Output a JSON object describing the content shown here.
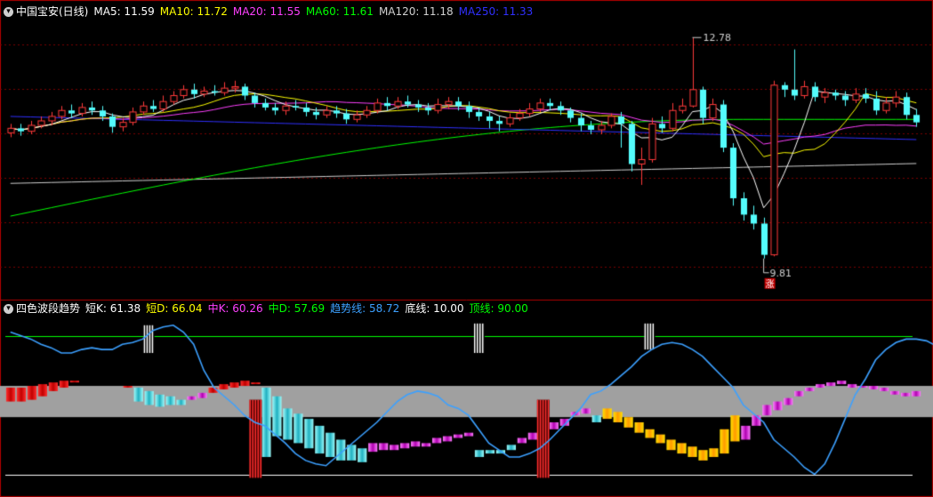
{
  "main_chart": {
    "title": "中国宝安(日线)",
    "ma": [
      {
        "label": "MA5: 11.59",
        "color": "#ffffff"
      },
      {
        "label": "MA10: 11.72",
        "color": "#ffff00"
      },
      {
        "label": "MA20: 11.55",
        "color": "#ff40ff"
      },
      {
        "label": "MA60: 11.61",
        "color": "#00ff00"
      },
      {
        "label": "MA120: 11.18",
        "color": "#d0d0d0"
      },
      {
        "label": "MA250: 11.33",
        "color": "#3030ff"
      }
    ],
    "high_label": "12.78",
    "low_label": "9.81",
    "limit_badge": "涨",
    "colors": {
      "up": "#ff3a3a",
      "down": "#54fcfc",
      "grid": "#7a0000",
      "border": "#b00000"
    }
  },
  "indicator": {
    "title": "四色波段趋势",
    "items": [
      {
        "label": "短K: 61.38",
        "color": "#ffffff"
      },
      {
        "label": "短D: 66.04",
        "color": "#ffff00"
      },
      {
        "label": "中K: 60.26",
        "color": "#ff40ff"
      },
      {
        "label": "中D: 57.69",
        "color": "#00ff00"
      },
      {
        "label": "趋势线: 58.72",
        "color": "#3ca0ff"
      },
      {
        "label": "底线: 10.00",
        "color": "#ffffff"
      },
      {
        "label": "顶线: 90.00",
        "color": "#00ff00"
      }
    ],
    "bottom_line": 10,
    "top_line": 90,
    "colors": {
      "red": "#e01010",
      "yellow": "#ffcc00",
      "cyan": "#54fcfc",
      "magenta": "#ff40ff",
      "trend": "#3ca0ff",
      "band": "#a0a0a0"
    }
  },
  "chart_data": {
    "type": "candlestick",
    "price_candles": [
      [
        11.5,
        11.56,
        11.62,
        11.44
      ],
      [
        11.56,
        11.52,
        11.62,
        11.46
      ],
      [
        11.52,
        11.6,
        11.66,
        11.48
      ],
      [
        11.6,
        11.66,
        11.72,
        11.56
      ],
      [
        11.66,
        11.72,
        11.78,
        11.6
      ],
      [
        11.72,
        11.8,
        11.86,
        11.68
      ],
      [
        11.8,
        11.76,
        11.88,
        11.7
      ],
      [
        11.76,
        11.84,
        11.9,
        11.72
      ],
      [
        11.84,
        11.8,
        11.92,
        11.74
      ],
      [
        11.8,
        11.72,
        11.86,
        11.66
      ],
      [
        11.72,
        11.58,
        11.76,
        11.5
      ],
      [
        11.58,
        11.64,
        11.7,
        11.52
      ],
      [
        11.64,
        11.78,
        11.84,
        11.6
      ],
      [
        11.78,
        11.86,
        11.92,
        11.74
      ],
      [
        11.86,
        11.82,
        11.94,
        11.78
      ],
      [
        11.82,
        11.92,
        12.0,
        11.78
      ],
      [
        11.92,
        12.0,
        12.06,
        11.88
      ],
      [
        12.0,
        12.08,
        12.14,
        11.96
      ],
      [
        12.08,
        12.02,
        12.16,
        11.96
      ],
      [
        12.02,
        12.06,
        12.12,
        11.98
      ],
      [
        12.06,
        12.04,
        12.14,
        12.0
      ],
      [
        12.04,
        12.1,
        12.18,
        12.0
      ],
      [
        12.1,
        12.12,
        12.2,
        12.04
      ],
      [
        12.12,
        12.0,
        12.16,
        11.94
      ],
      [
        12.0,
        11.9,
        12.04,
        11.84
      ],
      [
        11.9,
        11.84,
        11.96,
        11.8
      ],
      [
        11.84,
        11.8,
        11.9,
        11.74
      ],
      [
        11.8,
        11.86,
        11.92,
        11.74
      ],
      [
        11.86,
        11.84,
        11.94,
        11.8
      ],
      [
        11.84,
        11.78,
        11.9,
        11.72
      ],
      [
        11.78,
        11.74,
        11.84,
        11.68
      ],
      [
        11.74,
        11.8,
        11.86,
        11.7
      ],
      [
        11.8,
        11.76,
        11.86,
        11.7
      ],
      [
        11.76,
        11.68,
        11.82,
        11.62
      ],
      [
        11.68,
        11.74,
        11.8,
        11.64
      ],
      [
        11.74,
        11.8,
        11.86,
        11.7
      ],
      [
        11.8,
        11.9,
        11.96,
        11.76
      ],
      [
        11.9,
        11.86,
        11.98,
        11.8
      ],
      [
        11.86,
        11.92,
        11.98,
        11.82
      ],
      [
        11.92,
        11.88,
        12.0,
        11.84
      ],
      [
        11.88,
        11.84,
        11.94,
        11.78
      ],
      [
        11.84,
        11.8,
        11.9,
        11.74
      ],
      [
        11.8,
        11.88,
        11.96,
        11.76
      ],
      [
        11.88,
        11.92,
        11.98,
        11.82
      ],
      [
        11.92,
        11.86,
        11.98,
        11.8
      ],
      [
        11.86,
        11.78,
        11.92,
        11.7
      ],
      [
        11.78,
        11.72,
        11.84,
        11.66
      ],
      [
        11.72,
        11.66,
        11.78,
        11.56
      ],
      [
        11.66,
        11.62,
        11.72,
        11.52
      ],
      [
        11.62,
        11.7,
        11.76,
        11.58
      ],
      [
        11.7,
        11.76,
        11.82,
        11.66
      ],
      [
        11.76,
        11.82,
        11.9,
        11.72
      ],
      [
        11.82,
        11.9,
        11.96,
        11.78
      ],
      [
        11.9,
        11.86,
        11.96,
        11.8
      ],
      [
        11.86,
        11.8,
        11.92,
        11.74
      ],
      [
        11.8,
        11.7,
        11.84,
        11.64
      ],
      [
        11.7,
        11.6,
        11.76,
        11.52
      ],
      [
        11.6,
        11.54,
        11.66,
        11.48
      ],
      [
        11.54,
        11.6,
        11.66,
        11.48
      ],
      [
        11.6,
        11.72,
        11.76,
        11.56
      ],
      [
        11.72,
        11.62,
        11.78,
        11.3
      ],
      [
        11.62,
        11.08,
        11.66,
        10.98
      ],
      [
        11.08,
        11.14,
        11.3,
        10.8
      ],
      [
        11.14,
        11.62,
        11.7,
        11.1
      ],
      [
        11.62,
        11.56,
        11.72,
        11.5
      ],
      [
        11.56,
        11.8,
        11.9,
        11.52
      ],
      [
        11.8,
        11.86,
        11.96,
        11.76
      ],
      [
        11.86,
        12.08,
        12.78,
        11.84
      ],
      [
        12.08,
        11.7,
        12.12,
        11.62
      ],
      [
        11.7,
        11.88,
        11.96,
        11.66
      ],
      [
        11.88,
        11.3,
        11.94,
        11.24
      ],
      [
        11.3,
        10.62,
        11.36,
        10.52
      ],
      [
        10.62,
        10.4,
        10.7,
        10.32
      ],
      [
        10.4,
        10.28,
        10.52,
        10.2
      ],
      [
        10.28,
        9.86,
        10.36,
        9.81
      ],
      [
        9.86,
        12.14,
        12.2,
        9.84
      ],
      [
        12.14,
        12.08,
        12.18,
        11.98
      ],
      [
        12.08,
        12.0,
        12.62,
        11.94
      ],
      [
        12.0,
        12.12,
        12.2,
        11.96
      ],
      [
        12.12,
        11.98,
        12.18,
        11.92
      ],
      [
        11.98,
        12.04,
        12.1,
        11.9
      ],
      [
        12.04,
        12.0,
        12.08,
        11.94
      ],
      [
        12.0,
        11.94,
        12.06,
        11.86
      ],
      [
        11.94,
        12.02,
        12.1,
        11.9
      ],
      [
        12.02,
        11.96,
        12.1,
        11.9
      ],
      [
        11.96,
        11.8,
        12.06,
        11.74
      ],
      [
        11.8,
        11.9,
        11.98,
        11.76
      ],
      [
        11.9,
        11.98,
        12.06,
        11.84
      ],
      [
        11.98,
        11.74,
        12.04,
        11.68
      ],
      [
        11.74,
        11.64,
        11.82,
        11.58
      ]
    ],
    "moving_averages": {
      "MA5": [
        11.55,
        11.57,
        11.6,
        11.66,
        11.74,
        11.78,
        11.8,
        11.78,
        11.74,
        11.72,
        11.74,
        11.8,
        11.86,
        11.92,
        11.98,
        12.04,
        12.06,
        12.06,
        12.04,
        12.02,
        11.98,
        11.92,
        11.86,
        11.84,
        11.82,
        11.8,
        11.8,
        11.82,
        11.84,
        11.86,
        11.86,
        11.84,
        11.84,
        11.86,
        11.88,
        11.86,
        11.82,
        11.78,
        11.72,
        11.7,
        11.72,
        11.76,
        11.8,
        11.82,
        11.8,
        11.76,
        11.66,
        11.54,
        11.42,
        11.4,
        11.48,
        11.6,
        11.7,
        11.78,
        11.82,
        11.76,
        11.56,
        11.3,
        11.0,
        10.76,
        10.5,
        10.3,
        10.66,
        11.0,
        11.36,
        11.66,
        11.94,
        12.04,
        12.06,
        12.06,
        12.04,
        12.0,
        11.98,
        11.96,
        11.94,
        11.92,
        11.88,
        11.82
      ],
      "MA10": [
        11.6,
        11.61,
        11.62,
        11.64,
        11.68,
        11.72,
        11.75,
        11.78,
        11.8,
        11.8,
        11.82,
        11.84,
        11.87,
        11.9,
        11.92,
        11.94,
        11.96,
        11.97,
        11.96,
        11.94,
        11.92,
        11.9,
        11.88,
        11.87,
        11.86,
        11.85,
        11.84,
        11.84,
        11.85,
        11.86,
        11.86,
        11.86,
        11.85,
        11.84,
        11.83,
        11.82,
        11.8,
        11.78,
        11.76,
        11.74,
        11.73,
        11.74,
        11.76,
        11.78,
        11.78,
        11.76,
        11.72,
        11.66,
        11.58,
        11.52,
        11.48,
        11.46,
        11.46,
        11.48,
        11.5,
        11.48,
        11.4,
        11.28,
        11.14,
        11.02,
        10.94,
        10.92,
        11.0,
        11.12,
        11.26,
        11.4,
        11.54,
        11.66,
        11.76,
        11.84,
        11.9,
        11.94,
        11.96,
        11.96,
        11.94,
        11.92,
        11.88,
        11.84
      ]
    },
    "indicator_bars": [
      [
        52,
        60,
        "red"
      ],
      [
        52,
        60,
        "red"
      ],
      [
        53,
        61,
        "red"
      ],
      [
        55,
        62,
        "red"
      ],
      [
        58,
        63,
        "red"
      ],
      [
        60,
        64,
        "red"
      ],
      [
        63,
        64,
        "red"
      ],
      [
        65,
        65,
        "red"
      ],
      [
        64,
        64,
        "red"
      ],
      [
        63,
        63,
        "red"
      ],
      [
        62,
        62,
        "red"
      ],
      [
        60,
        61,
        "red"
      ],
      [
        52,
        60,
        "cyan"
      ],
      [
        50,
        58,
        "cyan"
      ],
      [
        49,
        56,
        "cyan"
      ],
      [
        50,
        55,
        "cyan"
      ],
      [
        50,
        53,
        "cyan"
      ],
      [
        53,
        55,
        "magenta"
      ],
      [
        54,
        57,
        "magenta"
      ],
      [
        57,
        60,
        "red"
      ],
      [
        59,
        62,
        "red"
      ],
      [
        60,
        63,
        "red"
      ],
      [
        61,
        64,
        "red"
      ],
      [
        62,
        63,
        "red"
      ],
      [
        20,
        60,
        "cyan"
      ],
      [
        32,
        55,
        "cyan"
      ],
      [
        30,
        48,
        "cyan"
      ],
      [
        28,
        45,
        "cyan"
      ],
      [
        25,
        42,
        "cyan"
      ],
      [
        22,
        38,
        "cyan"
      ],
      [
        20,
        34,
        "cyan"
      ],
      [
        18,
        30,
        "cyan"
      ],
      [
        18,
        27,
        "cyan"
      ],
      [
        17,
        25,
        "cyan"
      ],
      [
        23,
        28,
        "magenta"
      ],
      [
        24,
        28,
        "magenta"
      ],
      [
        24,
        27,
        "magenta"
      ],
      [
        25,
        28,
        "magenta"
      ],
      [
        26,
        29,
        "magenta"
      ],
      [
        26,
        28,
        "magenta"
      ],
      [
        28,
        31,
        "magenta"
      ],
      [
        29,
        32,
        "magenta"
      ],
      [
        31,
        33,
        "magenta"
      ],
      [
        32,
        34,
        "magenta"
      ],
      [
        20,
        24,
        "cyan"
      ],
      [
        22,
        24,
        "cyan"
      ],
      [
        22,
        24,
        "cyan"
      ],
      [
        24,
        27,
        "cyan"
      ],
      [
        28,
        31,
        "magenta"
      ],
      [
        30,
        34,
        "magenta"
      ],
      [
        34,
        37,
        "magenta"
      ],
      [
        36,
        40,
        "magenta"
      ],
      [
        38,
        42,
        "magenta"
      ],
      [
        44,
        46,
        "magenta"
      ],
      [
        45,
        48,
        "magenta"
      ],
      [
        40,
        44,
        "cyan"
      ],
      [
        42,
        48,
        "yellow"
      ],
      [
        40,
        46,
        "yellow"
      ],
      [
        37,
        43,
        "yellow"
      ],
      [
        34,
        40,
        "yellow"
      ],
      [
        31,
        36,
        "yellow"
      ],
      [
        28,
        33,
        "yellow"
      ],
      [
        24,
        30,
        "yellow"
      ],
      [
        22,
        28,
        "yellow"
      ],
      [
        20,
        26,
        "yellow"
      ],
      [
        18,
        24,
        "yellow"
      ],
      [
        20,
        25,
        "yellow"
      ],
      [
        22,
        36,
        "yellow"
      ],
      [
        29,
        44,
        "yellow"
      ],
      [
        30,
        38,
        "magenta"
      ],
      [
        38,
        44,
        "magenta"
      ],
      [
        44,
        50,
        "magenta"
      ],
      [
        47,
        52,
        "magenta"
      ],
      [
        50,
        54,
        "magenta"
      ],
      [
        55,
        58,
        "magenta"
      ],
      [
        58,
        60,
        "magenta"
      ],
      [
        60,
        62,
        "magenta"
      ],
      [
        61,
        63,
        "magenta"
      ],
      [
        62,
        64,
        "magenta"
      ],
      [
        60,
        62,
        "magenta"
      ],
      [
        60,
        61,
        "magenta"
      ],
      [
        59,
        61,
        "magenta"
      ],
      [
        58,
        60,
        "magenta"
      ],
      [
        56,
        58,
        "magenta"
      ],
      [
        55,
        57,
        "magenta"
      ],
      [
        55,
        58,
        "magenta"
      ]
    ]
  }
}
